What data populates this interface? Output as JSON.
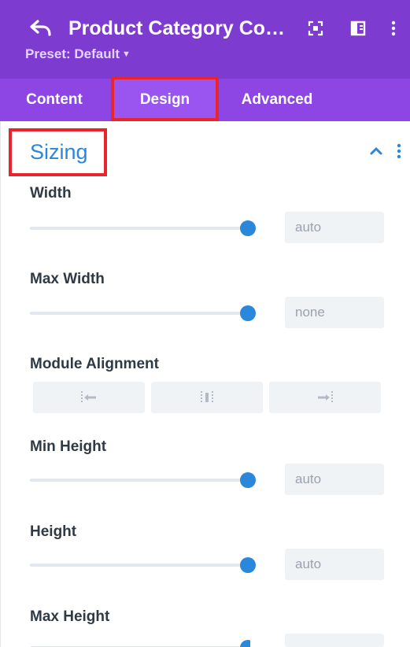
{
  "header": {
    "title": "Product Category Com…",
    "preset_label": "Preset: Default",
    "icons": [
      "back-arrow-icon",
      "focus-expand-icon",
      "split-view-icon",
      "more-vertical-icon"
    ]
  },
  "tabs": [
    {
      "label": "Content",
      "active": false
    },
    {
      "label": "Design",
      "active": true
    },
    {
      "label": "Advanced",
      "active": false
    }
  ],
  "section": {
    "title": "Sizing",
    "icons": [
      "chevron-up-icon",
      "more-vertical-icon"
    ]
  },
  "fields": {
    "width": {
      "label": "Width",
      "value": "auto"
    },
    "max_width": {
      "label": "Max Width",
      "value": "none"
    },
    "module_alignment": {
      "label": "Module Alignment",
      "options": [
        "align-left-icon",
        "align-center-icon",
        "align-right-icon"
      ]
    },
    "min_height": {
      "label": "Min Height",
      "value": "auto"
    },
    "height": {
      "label": "Height",
      "value": "auto"
    },
    "max_height": {
      "label": "Max Height"
    }
  },
  "colors": {
    "header_bg": "#7e3bd0",
    "tabs_bg": "#8d46e4",
    "active_tab_bg": "#9a55f0",
    "accent": "#2b87da",
    "highlight_border": "#e8242d"
  }
}
